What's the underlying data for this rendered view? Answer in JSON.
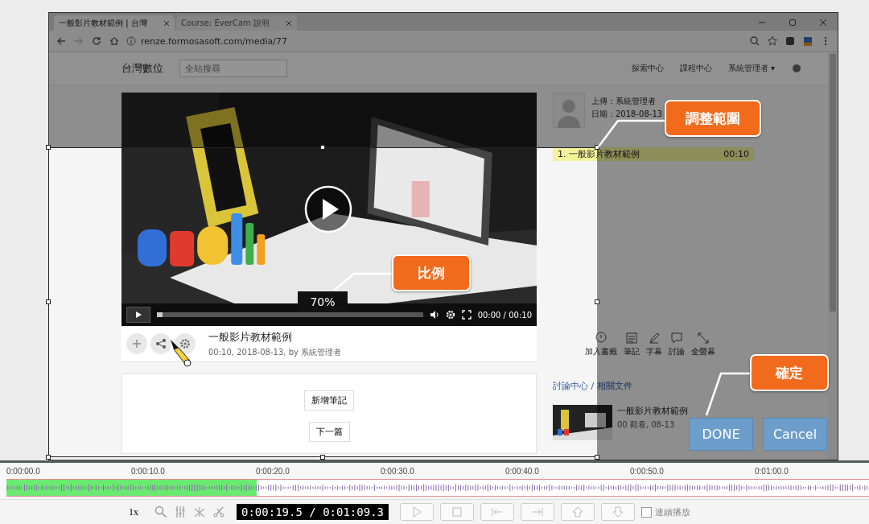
{
  "browser": {
    "tabs": [
      {
        "title": "一般影片教材範例 | 台灣",
        "selected": true
      },
      {
        "title": "Course: EverCam 說明",
        "selected": false
      }
    ],
    "url": "renze.formosasoft.com/media/77",
    "site": {
      "logo": "台灣數位",
      "search_placeholder": "全站搜尋",
      "nav": [
        "探索中心",
        "課程中心",
        "系統管理者 ▾"
      ]
    }
  },
  "video": {
    "time": "00:00 / 00:10",
    "progress": {
      "level": 0.02
    }
  },
  "media": {
    "title": "一般影片教材範例",
    "meta": "00:10, 2018-08-13, by 系統管理者",
    "buttons": [
      "新增筆記",
      "下一篇"
    ]
  },
  "sidebar": {
    "uploader": "上傳：系統管理者",
    "date": "日期：2018-08-13",
    "chapter": {
      "label": "1. 一般影片教材範例",
      "time": "00:10"
    },
    "tools": [
      "加入書籤",
      "筆記",
      "字幕",
      "討論",
      "全螢幕"
    ],
    "breadcrumb": "討論中心 / 相關文件",
    "related": {
      "title": "一般影片教材範例",
      "meta": "00 觀看, 08-13"
    }
  },
  "editor": {
    "scale_label": "70%",
    "callouts": [
      "調整範圍",
      "比例",
      "確定"
    ],
    "buttons": [
      "DONE",
      "Cancel"
    ]
  },
  "timeline": {
    "ticks": [
      "0:00:00.0",
      "0:00:10.0",
      "0:00:20.0",
      "0:00:30.0",
      "0:00:40.0",
      "0:00:50.0",
      "0:01:00.0"
    ],
    "selection": {
      "level": 0.29
    }
  },
  "toolbar": {
    "speed": "1x",
    "time": "0:00:19.5 / 0:01:09.3",
    "continuous": {
      "label": "連續播放",
      "checked": false
    }
  }
}
